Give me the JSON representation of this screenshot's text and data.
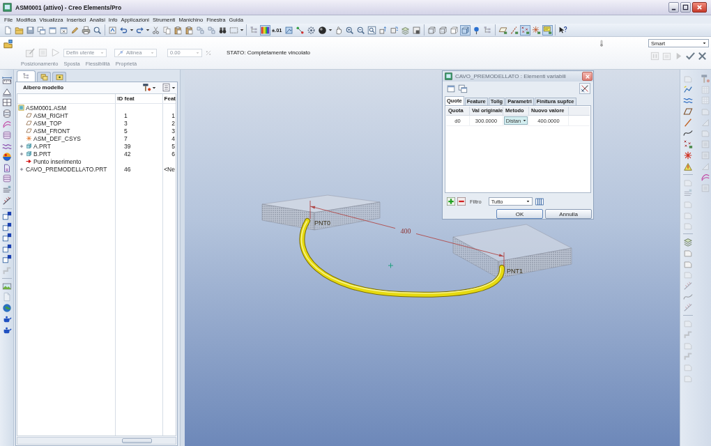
{
  "window": {
    "title": "ASM0001 (attivo) - Creo Elements/Pro"
  },
  "menu": [
    "File",
    "Modifica",
    "Visualizza",
    "Inserisci",
    "Analisi",
    "Info",
    "Applicazioni",
    "Strumenti",
    "Manichino",
    "Finestra",
    "Guida"
  ],
  "toolbar": [
    [
      {
        "pressed": false
      },
      {
        "pressed": false
      },
      {
        "pressed": false
      },
      {
        "pressed": false
      },
      {
        "pressed": false
      },
      {
        "pressed": false
      },
      {
        "pressed": false
      },
      {
        "pressed": false
      },
      {
        "pressed": false
      }
    ],
    [
      {
        "pressed": false
      },
      {
        "pressed": false
      },
      {
        "pressed": false
      },
      {
        "pressed": false
      },
      {
        "pressed": false
      },
      {
        "pressed": false
      },
      {
        "pressed": false
      },
      {
        "pressed": false
      },
      {
        "pressed": false
      },
      {
        "pressed": false
      },
      {
        "pressed": false
      }
    ],
    [
      {
        "pressed": false
      },
      {
        "pressed": true
      },
      {
        "label": "±.01",
        "pressed": false
      },
      {
        "pressed": false
      },
      {
        "pressed": false
      },
      {
        "pressed": false
      },
      {
        "pressed": false
      },
      {
        "pressed": false
      },
      {
        "pressed": false
      },
      {
        "pressed": false
      },
      {
        "pressed": false
      },
      {
        "pressed": false
      },
      {
        "pressed": false
      },
      {
        "pressed": false
      },
      {
        "pressed": false
      }
    ],
    [
      {
        "pressed": false
      },
      {
        "pressed": false
      },
      {
        "pressed": false
      },
      {
        "pressed": true
      },
      {
        "pressed": false
      },
      {
        "pressed": false
      }
    ],
    [
      {
        "pressed": false
      },
      {
        "pressed": false
      },
      {
        "pressed": true
      },
      {
        "pressed": false
      },
      {
        "pressed": true
      }
    ],
    [
      {
        "pressed": false
      }
    ]
  ],
  "dashboard": {
    "tools": [
      {
        "disabled": true
      },
      {
        "disabled": true
      },
      {
        "disabled": true
      }
    ],
    "constraint_set": {
      "value": "Defin utente",
      "disabled": true
    },
    "constraint": {
      "value": "Allinea",
      "disabled": true
    },
    "offset": {
      "value": "0.00",
      "disabled": true
    },
    "status": "STATO: Completamente vincolato",
    "tabs": [
      {
        "label": "Posizionamento",
        "disabled": true
      },
      {
        "label": "Sposta",
        "disabled": true
      },
      {
        "label": "Flessibilità",
        "disabled": true
      },
      {
        "label": "Proprietà",
        "disabled": true
      }
    ],
    "filter": {
      "value": "Smart"
    },
    "actions": [
      {
        "disabled": true
      },
      {
        "disabled": true
      },
      {
        "disabled": true
      },
      {
        "disabled": false
      },
      {
        "disabled": false
      }
    ]
  },
  "left_toolbar": [
    [
      {
        "disabled": false
      },
      {
        "disabled": false
      },
      {
        "disabled": false
      },
      {
        "disabled": false
      },
      {
        "disabled": false
      },
      {
        "disabled": false
      },
      {
        "disabled": false
      },
      {
        "disabled": false
      },
      {
        "disabled": false
      },
      {
        "disabled": false
      },
      {
        "disabled": false
      },
      {
        "disabled": false
      }
    ],
    [
      {
        "disabled": false
      },
      {
        "disabled": false
      },
      {
        "disabled": false
      },
      {
        "disabled": false
      },
      {
        "disabled": false
      },
      {
        "disabled": true
      }
    ],
    [
      {
        "disabled": false
      },
      {
        "disabled": true
      },
      {
        "disabled": false
      },
      {
        "disabled": false
      },
      {
        "disabled": false
      }
    ]
  ],
  "model_tree": {
    "tabs": [
      {
        "selected": true
      },
      {
        "selected": false
      },
      {
        "selected": false
      }
    ],
    "title": "Albero modello",
    "columns": [
      "ID feat",
      "Feat"
    ],
    "items": [
      {
        "kind": "assembly",
        "name": "ASM0001.ASM",
        "children": [
          {
            "kind": "datum-plane",
            "name": "ASM_RIGHT",
            "id": "1",
            "feat": "1"
          },
          {
            "kind": "datum-plane",
            "name": "ASM_TOP",
            "id": "3",
            "feat": "2"
          },
          {
            "kind": "datum-plane",
            "name": "ASM_FRONT",
            "id": "5",
            "feat": "3"
          },
          {
            "kind": "csys",
            "name": "ASM_DEF_CSYS",
            "id": "7",
            "feat": "4"
          },
          {
            "kind": "part",
            "name": "A.PRT",
            "id": "39",
            "feat": "5",
            "expanded": false
          },
          {
            "kind": "part",
            "name": "B.PRT",
            "id": "42",
            "feat": "6",
            "expanded": false
          },
          {
            "kind": "insert-point",
            "name": "Punto inserimento"
          },
          {
            "kind": "cable",
            "name": "CAVO_PREMODELLATO.PRT",
            "id": "46",
            "feat": "<Ne",
            "expanded": false
          }
        ]
      }
    ]
  },
  "viewport": {
    "dimension": "400",
    "points": [
      "PNT0",
      "PNT1"
    ]
  },
  "dialog": {
    "title": "CAVO_PREMODELLATO : Elementi variabili",
    "tabs": [
      {
        "label": "Quote",
        "selected": true
      },
      {
        "label": "Feature",
        "selected": false
      },
      {
        "label": "Tollg",
        "selected": false
      },
      {
        "label": "Parametri",
        "selected": false
      },
      {
        "label": "Finitura supfce",
        "selected": false
      }
    ],
    "columns": [
      "Quota",
      "Val originale",
      "Metodo",
      "Nuovo valore"
    ],
    "rows": [
      {
        "quota": "d0",
        "val_originale": "300.0000",
        "metodo": "Distan",
        "nuovo_valore": "400.0000"
      }
    ],
    "filter_label": "Filtro",
    "filter": "Tutto",
    "buttons": [
      "OK",
      "Annulla"
    ]
  },
  "right_toolbar": {
    "columns": [
      {
        "groups": [
          [
            {
              "disabled": true
            },
            {
              "disabled": false
            },
            {
              "disabled": false
            },
            {
              "disabled": false
            },
            {
              "disabled": false
            },
            {
              "disabled": false
            },
            {
              "disabled": false
            },
            {
              "disabled": false
            },
            {
              "disabled": false
            }
          ],
          [
            {
              "disabled": true
            },
            {
              "disabled": true
            },
            {
              "disabled": true
            },
            {
              "disabled": true
            },
            {
              "disabled": true
            }
          ],
          [
            {
              "disabled": false
            },
            {
              "disabled": false
            },
            {
              "disabled": false
            },
            {
              "disabled": true
            },
            {
              "disabled": true
            },
            {
              "disabled": true
            },
            {
              "disabled": true
            }
          ],
          [
            {
              "disabled": true
            },
            {
              "disabled": true
            },
            {
              "disabled": true
            },
            {
              "disabled": true
            },
            {
              "disabled": true
            },
            {
              "disabled": true
            }
          ]
        ]
      },
      {
        "groups": [
          [
            {
              "disabled": true
            },
            {
              "disabled": true
            },
            {
              "disabled": true
            },
            {
              "disabled": true
            },
            {
              "disabled": true
            },
            {
              "disabled": true
            },
            {
              "disabled": true
            },
            {
              "disabled": true
            },
            {
              "disabled": true
            },
            {
              "disabled": false
            },
            {
              "disabled": true
            }
          ]
        ]
      }
    ]
  }
}
